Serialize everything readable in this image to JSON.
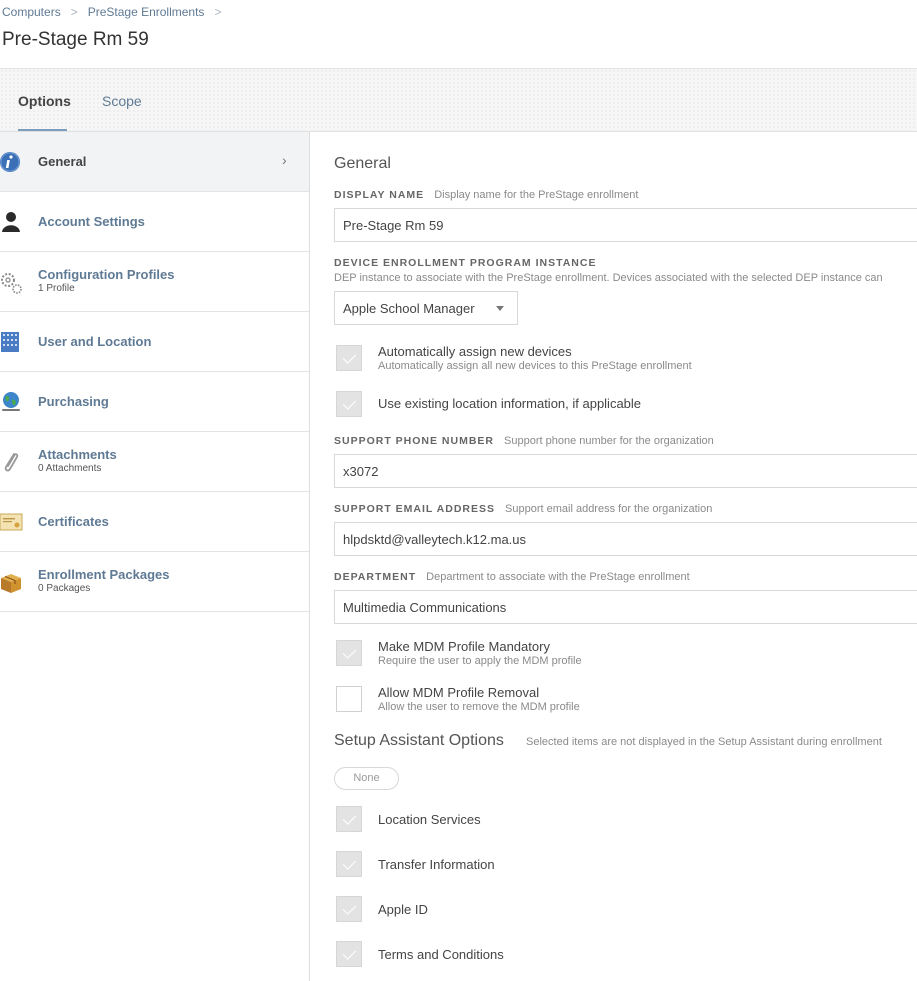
{
  "breadcrumb": {
    "items": [
      "Computers",
      "PreStage Enrollments"
    ],
    "separator": ">"
  },
  "page_title": "Pre-Stage Rm 59",
  "tabs": [
    {
      "label": "Options",
      "active": true
    },
    {
      "label": "Scope",
      "active": false
    }
  ],
  "sidebar": {
    "items": [
      {
        "label": "General",
        "sub": "",
        "icon": "info-icon",
        "active": true
      },
      {
        "label": "Account Settings",
        "sub": "",
        "icon": "user-silhouette-icon"
      },
      {
        "label": "Configuration Profiles",
        "sub": "1 Profile",
        "icon": "gears-icon"
      },
      {
        "label": "User and Location",
        "sub": "",
        "icon": "building-icon"
      },
      {
        "label": "Purchasing",
        "sub": "",
        "icon": "globe-icon"
      },
      {
        "label": "Attachments",
        "sub": "0 Attachments",
        "icon": "paperclip-icon"
      },
      {
        "label": "Certificates",
        "sub": "",
        "icon": "certificate-icon"
      },
      {
        "label": "Enrollment Packages",
        "sub": "0 Packages",
        "icon": "package-icon"
      }
    ]
  },
  "general": {
    "title": "General",
    "display_name": {
      "label": "DISPLAY NAME",
      "hint": "Display name for the PreStage enrollment",
      "value": "Pre-Stage Rm 59"
    },
    "dep_instance": {
      "label": "DEVICE ENROLLMENT PROGRAM INSTANCE",
      "description": "DEP instance to associate with the PreStage enrollment. Devices associated with the selected DEP instance can",
      "value": "Apple School Manager"
    },
    "auto_assign": {
      "label": "Automatically assign new devices",
      "sub": "Automatically assign all new devices to this PreStage enrollment",
      "checked": true
    },
    "use_location": {
      "label": "Use existing location information, if applicable",
      "checked": true
    },
    "support_phone": {
      "label": "SUPPORT PHONE NUMBER",
      "hint": "Support phone number for the organization",
      "value": "x3072"
    },
    "support_email": {
      "label": "SUPPORT EMAIL ADDRESS",
      "hint": "Support email address for the organization",
      "value": "hlpdsktd@valleytech.k12.ma.us"
    },
    "department": {
      "label": "DEPARTMENT",
      "hint": "Department to associate with the PreStage enrollment",
      "value": "Multimedia Communications"
    },
    "mdm_mandatory": {
      "label": "Make MDM Profile Mandatory",
      "sub": "Require the user to apply the MDM profile",
      "checked": true
    },
    "mdm_removal": {
      "label": "Allow MDM Profile Removal",
      "sub": "Allow the user to remove the MDM profile",
      "checked": false
    }
  },
  "setup_assistant": {
    "title": "Setup Assistant Options",
    "hint": "Selected items are not displayed in the Setup Assistant during enrollment",
    "none_button": "None",
    "items": [
      {
        "label": "Location Services",
        "checked": true
      },
      {
        "label": "Transfer Information",
        "checked": true
      },
      {
        "label": "Apple ID",
        "checked": true
      },
      {
        "label": "Terms and Conditions",
        "checked": true
      }
    ]
  }
}
